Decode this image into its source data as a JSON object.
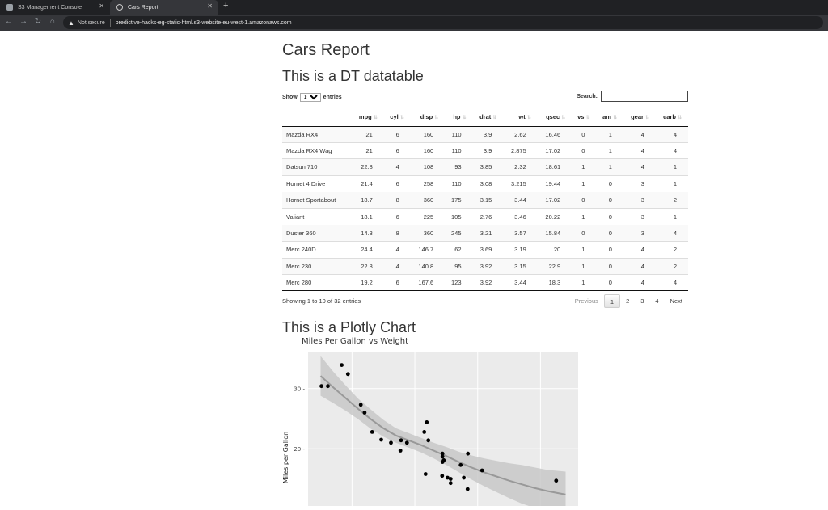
{
  "browser": {
    "tabs": [
      {
        "label": "S3 Management Console"
      },
      {
        "label": "Cars Report"
      }
    ],
    "address": {
      "security": "Not secure",
      "url": "predictive-hacks-eg-static-html.s3-website-eu-west-1.amazonaws.com"
    }
  },
  "page": {
    "title": "Cars Report",
    "table_heading": "This is a DT datatable",
    "plot_heading": "This is a Plotly Chart"
  },
  "datatable": {
    "show_label": "Show",
    "entries_label": "entries",
    "length_value": "10",
    "search_label": "Search:",
    "search_value": "",
    "columns": [
      "",
      "mpg",
      "cyl",
      "disp",
      "hp",
      "drat",
      "wt",
      "qsec",
      "vs",
      "am",
      "gear",
      "carb"
    ],
    "rows": [
      [
        "Mazda RX4",
        "21",
        "6",
        "160",
        "110",
        "3.9",
        "2.62",
        "16.46",
        "0",
        "1",
        "4",
        "4"
      ],
      [
        "Mazda RX4 Wag",
        "21",
        "6",
        "160",
        "110",
        "3.9",
        "2.875",
        "17.02",
        "0",
        "1",
        "4",
        "4"
      ],
      [
        "Datsun 710",
        "22.8",
        "4",
        "108",
        "93",
        "3.85",
        "2.32",
        "18.61",
        "1",
        "1",
        "4",
        "1"
      ],
      [
        "Hornet 4 Drive",
        "21.4",
        "6",
        "258",
        "110",
        "3.08",
        "3.215",
        "19.44",
        "1",
        "0",
        "3",
        "1"
      ],
      [
        "Hornet Sportabout",
        "18.7",
        "8",
        "360",
        "175",
        "3.15",
        "3.44",
        "17.02",
        "0",
        "0",
        "3",
        "2"
      ],
      [
        "Valiant",
        "18.1",
        "6",
        "225",
        "105",
        "2.76",
        "3.46",
        "20.22",
        "1",
        "0",
        "3",
        "1"
      ],
      [
        "Duster 360",
        "14.3",
        "8",
        "360",
        "245",
        "3.21",
        "3.57",
        "15.84",
        "0",
        "0",
        "3",
        "4"
      ],
      [
        "Merc 240D",
        "24.4",
        "4",
        "146.7",
        "62",
        "3.69",
        "3.19",
        "20",
        "1",
        "0",
        "4",
        "2"
      ],
      [
        "Merc 230",
        "22.8",
        "4",
        "140.8",
        "95",
        "3.92",
        "3.15",
        "22.9",
        "1",
        "0",
        "4",
        "2"
      ],
      [
        "Merc 280",
        "19.2",
        "6",
        "167.6",
        "123",
        "3.92",
        "3.44",
        "18.3",
        "1",
        "0",
        "4",
        "4"
      ]
    ],
    "info": "Showing 1 to 10 of 32 entries",
    "pager": {
      "previous": "Previous",
      "pages": [
        "1",
        "2",
        "3",
        "4"
      ],
      "current": "1",
      "next": "Next"
    }
  },
  "chart_data": {
    "type": "scatter",
    "title": "Miles Per Gallon vs Weight",
    "ylabel": "Miles per Gallon",
    "xlabel": "",
    "yticks": [
      20,
      30
    ],
    "xlim": [
      1.3,
      5.6
    ],
    "ylim": [
      10.5,
      36
    ],
    "grid": true,
    "x": [
      1.513,
      1.615,
      1.835,
      1.935,
      2.14,
      2.2,
      2.32,
      2.465,
      2.62,
      2.77,
      2.78,
      2.875,
      3.15,
      3.17,
      3.19,
      3.215,
      3.435,
      3.44,
      3.44,
      3.44,
      3.46,
      3.52,
      3.57,
      3.57,
      3.73,
      3.78,
      3.84,
      3.845,
      4.07,
      5.25
    ],
    "y": [
      30.4,
      30.4,
      33.9,
      32.4,
      27.3,
      26,
      22.8,
      21.5,
      21,
      19.7,
      21.4,
      21,
      22.8,
      15.8,
      24.4,
      21.4,
      15.5,
      18.7,
      19.2,
      17.8,
      18.1,
      15.2,
      14.3,
      15,
      17.3,
      15.2,
      13.3,
      19.2,
      16.4,
      14.7
    ],
    "smooth_x": [
      1.5,
      1.7,
      1.9,
      2.1,
      2.3,
      2.5,
      2.7,
      2.9,
      3.1,
      3.3,
      3.5,
      3.7,
      3.9,
      4.1,
      4.3,
      4.5,
      4.7,
      4.9,
      5.1,
      5.3,
      5.4
    ],
    "smooth_y": [
      32.1,
      30.2,
      28.4,
      26.6,
      24.9,
      23.4,
      22.2,
      21.4,
      20.6,
      19.7,
      18.8,
      17.8,
      16.9,
      16.1,
      15.4,
      14.7,
      14.1,
      13.5,
      13.0,
      12.6,
      12.4
    ],
    "band_lower": [
      28.8,
      27.6,
      26.3,
      24.9,
      23.3,
      22.0,
      21.0,
      20.2,
      19.4,
      18.4,
      17.3,
      16.1,
      14.9,
      13.8,
      12.8,
      11.8,
      10.9,
      10.2,
      9.5,
      8.9,
      8.6
    ],
    "band_upper": [
      35.4,
      32.8,
      30.5,
      28.3,
      26.5,
      24.8,
      23.4,
      22.6,
      21.8,
      21.0,
      20.3,
      19.5,
      18.9,
      18.4,
      18.0,
      17.6,
      17.3,
      16.9,
      16.5,
      16.3,
      16.2
    ],
    "colors": {
      "panel": "#ebebeb",
      "grid": "#ffffff",
      "band": "#c8c8c8",
      "line": "#999999",
      "point": "#000000"
    }
  }
}
